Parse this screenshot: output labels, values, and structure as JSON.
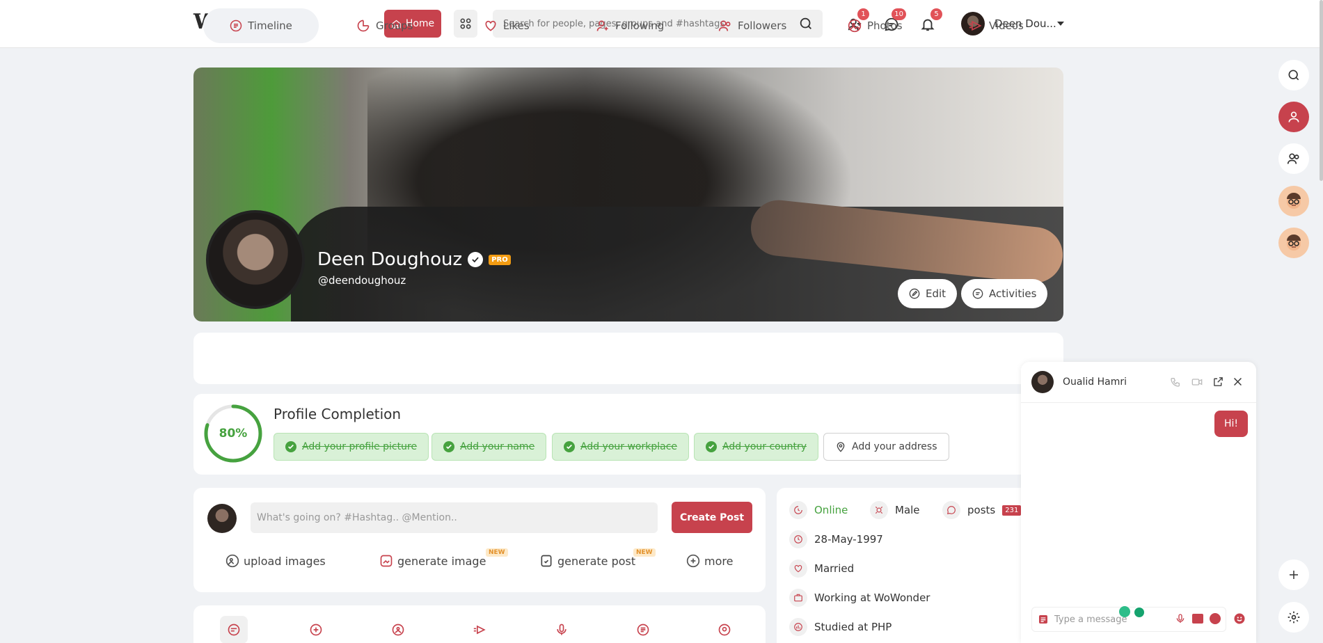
{
  "header": {
    "logo": "WoWonder",
    "home_label": "Home",
    "search_placeholder": "Search for people, pages, groups and #hashtags",
    "badges": {
      "friends": "1",
      "messages": "10",
      "notifications": "5"
    },
    "user_name": "Deen Dou..."
  },
  "profile": {
    "name": "Deen Doughouz",
    "pro_label": "PRO",
    "handle": "@deendoughouz",
    "edit_label": "Edit",
    "activities_label": "Activities"
  },
  "tabs": [
    {
      "label": "Timeline"
    },
    {
      "label": "Groups"
    },
    {
      "label": "Likes"
    },
    {
      "label": "Following"
    },
    {
      "label": "Followers"
    },
    {
      "label": "Photos"
    },
    {
      "label": "Videos"
    }
  ],
  "completion": {
    "percent_label": "80%",
    "percent": 0.8,
    "title": "Profile Completion",
    "items": [
      {
        "label": "Add your profile picture",
        "done": true
      },
      {
        "label": "Add your name",
        "done": true
      },
      {
        "label": "Add your workplace",
        "done": true
      },
      {
        "label": "Add your country",
        "done": true
      },
      {
        "label": "Add your address",
        "done": false
      }
    ]
  },
  "composer": {
    "placeholder": "What's going on? #Hashtag.. @Mention..",
    "create_label": "Create Post",
    "actions": [
      {
        "label": "upload images",
        "new": ""
      },
      {
        "label": "generate image",
        "new": "NEW"
      },
      {
        "label": "generate post",
        "new": "NEW"
      },
      {
        "label": "more",
        "new": ""
      }
    ]
  },
  "info": {
    "status": "Online",
    "gender": "Male",
    "posts_label": "posts",
    "posts_count": "231",
    "birthday": "28-May-1997",
    "relationship": "Married",
    "work": "Working at WoWonder",
    "study": "Studied at PHP"
  },
  "chat": {
    "name": "Oualid Hamri",
    "message": "Hi!",
    "input_placeholder": "Type a message"
  },
  "colors": {
    "accent": "#c7424d",
    "success": "#46a23f"
  }
}
